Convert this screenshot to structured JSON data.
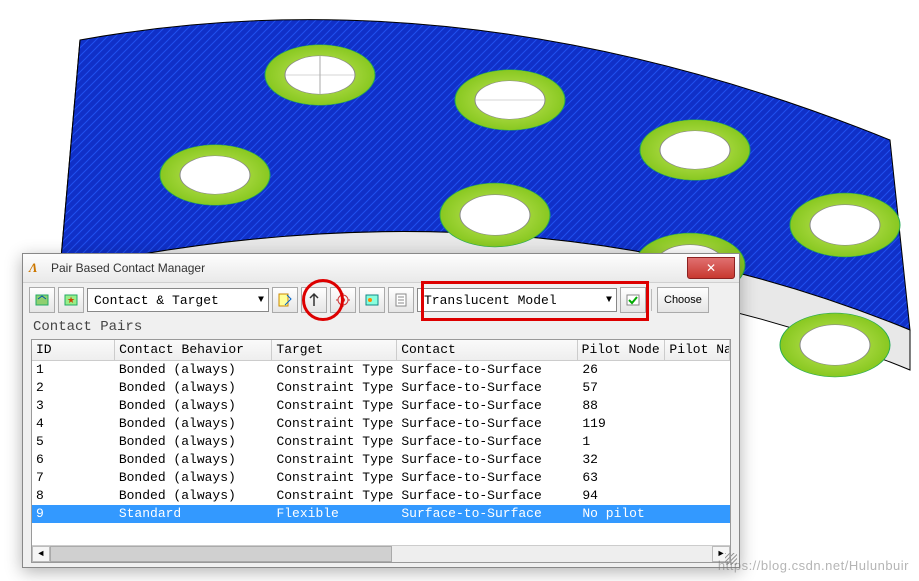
{
  "window": {
    "title": "Pair Based Contact Manager"
  },
  "toolbar": {
    "view_dropdown": "Contact & Target",
    "display_dropdown": "Translucent Model",
    "choose_label": "Choose"
  },
  "section": {
    "label": "Contact Pairs"
  },
  "columns": {
    "id": "ID",
    "behavior": "Contact Behavior",
    "target": "Target",
    "contact": "Contact",
    "pilot_node": "Pilot Node",
    "pilot_name": "Pilot Na"
  },
  "rows": [
    {
      "id": "1",
      "behavior": "Bonded (always)",
      "target": "Constraint Type",
      "contact": "Surface-to-Surface",
      "pilot": "26",
      "pilotn": ""
    },
    {
      "id": "2",
      "behavior": "Bonded (always)",
      "target": "Constraint Type",
      "contact": "Surface-to-Surface",
      "pilot": "57",
      "pilotn": ""
    },
    {
      "id": "3",
      "behavior": "Bonded (always)",
      "target": "Constraint Type",
      "contact": "Surface-to-Surface",
      "pilot": "88",
      "pilotn": ""
    },
    {
      "id": "4",
      "behavior": "Bonded (always)",
      "target": "Constraint Type",
      "contact": "Surface-to-Surface",
      "pilot": "119",
      "pilotn": ""
    },
    {
      "id": "5",
      "behavior": "Bonded (always)",
      "target": "Constraint Type",
      "contact": "Surface-to-Surface",
      "pilot": "1",
      "pilotn": ""
    },
    {
      "id": "6",
      "behavior": "Bonded (always)",
      "target": "Constraint Type",
      "contact": "Surface-to-Surface",
      "pilot": "32",
      "pilotn": ""
    },
    {
      "id": "7",
      "behavior": "Bonded (always)",
      "target": "Constraint Type",
      "contact": "Surface-to-Surface",
      "pilot": "63",
      "pilotn": ""
    },
    {
      "id": "8",
      "behavior": "Bonded (always)",
      "target": "Constraint Type",
      "contact": "Surface-to-Surface",
      "pilot": "94",
      "pilotn": ""
    },
    {
      "id": "9",
      "behavior": "Standard",
      "target": "Flexible",
      "contact": "Surface-to-Surface",
      "pilot": "No pilot",
      "pilotn": ""
    }
  ],
  "selected_row_index": 8,
  "watermark": "https://blog.csdn.net/Hulunbuir"
}
